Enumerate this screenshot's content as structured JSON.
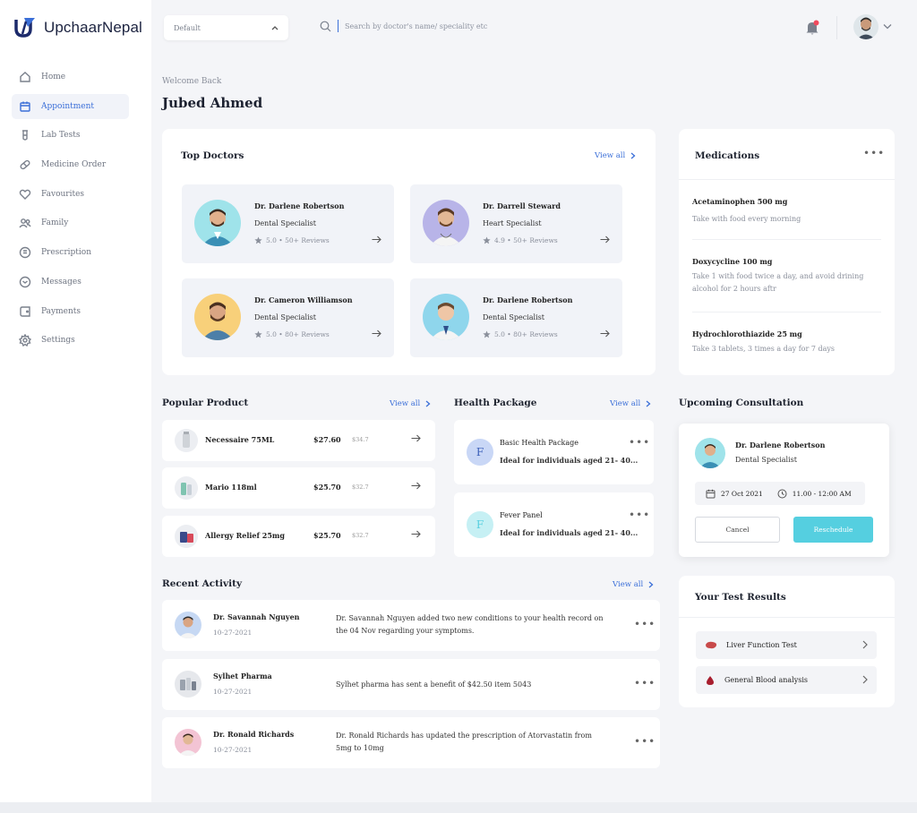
{
  "app": {
    "brand": "UpchaarNepal"
  },
  "sidebar": {
    "items": [
      {
        "label": "Home",
        "icon": "home-icon",
        "active": false
      },
      {
        "label": "Appointment",
        "icon": "calendar-icon",
        "active": true
      },
      {
        "label": "Lab Tests",
        "icon": "test-tube-icon",
        "active": false
      },
      {
        "label": "Medicine Order",
        "icon": "pill-icon",
        "active": false
      },
      {
        "label": "Favourites",
        "icon": "heart-icon",
        "active": false
      },
      {
        "label": "Family",
        "icon": "users-icon",
        "active": false
      },
      {
        "label": "Prescription",
        "icon": "document-icon",
        "active": false
      },
      {
        "label": "Messages",
        "icon": "envelope-icon",
        "active": false
      },
      {
        "label": "Payments",
        "icon": "wallet-icon",
        "active": false
      },
      {
        "label": "Settings",
        "icon": "gear-icon",
        "active": false
      }
    ]
  },
  "topbar": {
    "select_value": "Default",
    "search_placeholder": "Search by doctor's name/ speciality etc"
  },
  "welcome": {
    "greeting": "Welcome Back",
    "name": "Jubed Ahmed"
  },
  "top_doctors": {
    "title": "Top Doctors",
    "view_all": "View all",
    "items": [
      {
        "name": "Dr. Darlene Robertson",
        "specialty": "Dental Specialist",
        "rating": "5.0 • 50+ Reviews"
      },
      {
        "name": "Dr. Darrell Steward",
        "specialty": "Heart Specialist",
        "rating": "4.9 • 50+ Reviews"
      },
      {
        "name": "Dr. Cameron Williamson",
        "specialty": "Dental Specialist",
        "rating": "5.0 • 80+ Reviews"
      },
      {
        "name": "Dr. Darlene Robertson",
        "specialty": "Dental Specialist",
        "rating": "5.0 • 80+ Reviews"
      }
    ]
  },
  "medications": {
    "title": "Medications",
    "items": [
      {
        "name": "Acetaminophen 500 mg",
        "desc": "Take with food every morning"
      },
      {
        "name": "Doxycycline 100 mg",
        "desc": "Take 1 with food twice a day, and avoid drining alcohol for 2 hours aftr"
      },
      {
        "name": "Hydrochlorothiazide 25 mg",
        "desc": "Take 3 tablets, 3 times a day for 7 days"
      }
    ]
  },
  "popular_product": {
    "title": "Popular Product",
    "view_all": "View all",
    "items": [
      {
        "name": "Necessaire 75ML",
        "price": "$27.60",
        "old_price": "$34.7"
      },
      {
        "name": "Mario 118ml",
        "price": "$25.70",
        "old_price": "$32.7"
      },
      {
        "name": "Allergy Relief 25mg",
        "price": "$25.70",
        "old_price": "$32.7"
      }
    ]
  },
  "health_package": {
    "title": "Health Package",
    "view_all": "View all",
    "items": [
      {
        "badge": "F",
        "name": "Basic Health Package",
        "desc": "Ideal for individuals aged 21- 40..."
      },
      {
        "badge": "F",
        "name": "Fever Panel",
        "desc": "Ideal for individuals aged 21- 40..."
      }
    ]
  },
  "upcoming": {
    "title": "Upcoming Consultation",
    "doctor": "Dr. Darlene Robertson",
    "specialty": "Dental Specialist",
    "date": "27 Oct 2021",
    "time": "11.00 - 12:00 AM",
    "cancel": "Cancel",
    "reschedule": "Reschedule"
  },
  "recent_activity": {
    "title": "Recent Activity",
    "view_all": "View all",
    "items": [
      {
        "name": "Dr. Savannah Nguyen",
        "date": "10-27-2021",
        "text": "Dr. Savannah Nguyen added two new conditions to your health record on the 04 Nov regarding your symptoms."
      },
      {
        "name": "Sylhet Pharma",
        "date": "10-27-2021",
        "text": "Sylhet pharma has sent a benefit of $42.50 item 5043"
      },
      {
        "name": "Dr. Ronald Richards",
        "date": "10-27-2021",
        "text": "Dr. Ronald Richards has updated the prescription of Atorvastatin from 5mg to 10mg"
      }
    ]
  },
  "test_results": {
    "title": "Your Test Results",
    "items": [
      {
        "name": "Liver Function Test",
        "icon": "liver-icon"
      },
      {
        "name": "General Blood analysis",
        "icon": "blood-drop-icon"
      }
    ]
  },
  "colors": {
    "accent": "#3b6fd8",
    "cyan": "#55cfe0",
    "notify": "#f04a5e"
  }
}
